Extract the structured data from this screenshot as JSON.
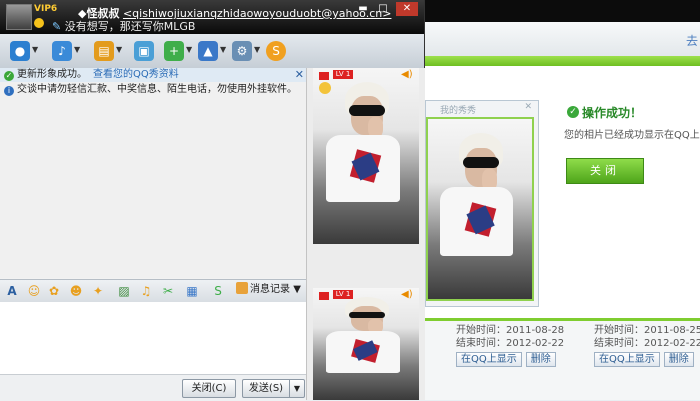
{
  "window": {
    "vip_label": "VIP6",
    "contact_nick": "◆怪叔叔",
    "contact_email": "<qishiwojiuxianqzhidaowoyouduobt@yahoo.cn>",
    "signature": "没有想写，那还写你MLGB",
    "controls": {
      "minimize": "▬",
      "maximize": "□",
      "close": "✕"
    }
  },
  "toolbar": {
    "items": [
      {
        "icon": "video-call-icon",
        "color": "#2b7fd0"
      },
      {
        "icon": "voice-call-icon",
        "color": "#3a8ad8"
      },
      {
        "icon": "send-file-icon",
        "color": "#e39b1d"
      },
      {
        "icon": "remote-assist-icon",
        "color": "#4a9fd6"
      },
      {
        "icon": "create-group-icon",
        "color": "#3fae4a"
      },
      {
        "icon": "app-tools-icon",
        "color": "#3a78c8"
      },
      {
        "icon": "settings-icon",
        "color": "#6a8fb4"
      },
      {
        "icon": "soso-icon",
        "color": "#f0a020"
      }
    ]
  },
  "messages": {
    "notice1_text": "更新形象成功。",
    "notice1_link": "查看您的QQ秀资料",
    "notice2_text": "交谈中请勿轻信汇款、中奖信息、陌生电话，勿使用外挂软件。"
  },
  "input_toolbar": {
    "history_label": "消息记录"
  },
  "actions": {
    "close_label": "关闭(C)",
    "send_label": "发送(S)"
  },
  "photo_badges": {
    "level": "LV 1"
  },
  "background": {
    "nav_text": "去",
    "success_title": "操作成功！",
    "success_desc": "您的相片已经成功显示在QQ上!",
    "success_close": "关闭",
    "ghost_title": "我的秀秀",
    "cards": [
      {
        "start": "开始时间：2011-08-28",
        "end": "结束时间：2012-02-22",
        "btn1": "在QQ上显示",
        "btn2": "删除"
      },
      {
        "start": "开始时间：2011-08-25",
        "end": "结束时间：2012-02-22",
        "btn1": "在QQ上显示",
        "btn2": "删除"
      }
    ]
  }
}
